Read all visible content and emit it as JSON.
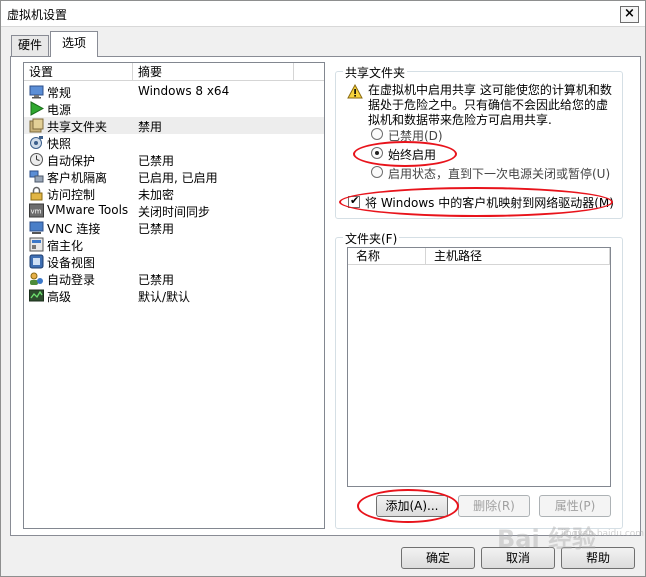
{
  "window": {
    "title": "虚拟机设置",
    "close_glyph": "×"
  },
  "tabs": [
    {
      "label": "硬件",
      "selected": false
    },
    {
      "label": "选项",
      "selected": true
    }
  ],
  "settings_list": {
    "headers": {
      "setting": "设置",
      "summary": "摘要"
    },
    "rows": [
      {
        "name": "常规",
        "summary": "Windows 8 x64",
        "icon": "monitor-icon"
      },
      {
        "name": "电源",
        "summary": "",
        "icon": "play-icon"
      },
      {
        "name": "共享文件夹",
        "summary": "禁用",
        "icon": "shared-folder-icon"
      },
      {
        "name": "快照",
        "summary": "",
        "icon": "snapshot-icon"
      },
      {
        "name": "自动保护",
        "summary": "已禁用",
        "icon": "clock-icon"
      },
      {
        "name": "客户机隔离",
        "summary": "已启用, 已启用",
        "icon": "isolation-icon"
      },
      {
        "name": "访问控制",
        "summary": "未加密",
        "icon": "lock-icon"
      },
      {
        "name": "VMware Tools",
        "summary": "关闭时间同步",
        "icon": "vm-tools-icon"
      },
      {
        "name": "VNC 连接",
        "summary": "已禁用",
        "icon": "vnc-icon"
      },
      {
        "name": "宿主化",
        "summary": "",
        "icon": "unity-icon"
      },
      {
        "name": "设备视图",
        "summary": "",
        "icon": "device-view-icon"
      },
      {
        "name": "自动登录",
        "summary": "已禁用",
        "icon": "autologin-icon"
      },
      {
        "name": "高级",
        "summary": "默认/默认",
        "icon": "advanced-icon"
      }
    ],
    "selected_index": 2
  },
  "shared_folders": {
    "legend": "共享文件夹",
    "warning": "在虚拟机中启用共享 这可能使您的计算机和数据处于危险之中。只有确信不会因此给您的虚拟机和数据带来危险方可启用共享.",
    "options": [
      {
        "label": "已禁用(D)",
        "checked": false
      },
      {
        "label": "始终启用",
        "checked": true
      },
      {
        "label": "启用状态，直到下一次电源关闭或暂停(U)",
        "checked": false
      }
    ],
    "map_drive_label": "将 Windows 中的客户机映射到网络驱动器(M)",
    "map_drive_checked": true,
    "check_glyph": "✔"
  },
  "folders": {
    "legend": "文件夹(F)",
    "columns": [
      "名称",
      "主机路径"
    ],
    "buttons": {
      "add": "添加(A)...",
      "remove": "删除(R)",
      "properties": "属性(P)"
    }
  },
  "footer": {
    "ok": "确定",
    "cancel": "取消",
    "help": "帮助"
  },
  "watermark": {
    "main": "Bai 经验",
    "sub": "jingyan.baidu.com"
  },
  "colors": {
    "annotation": "#e8131b",
    "selection": "#ededed"
  }
}
